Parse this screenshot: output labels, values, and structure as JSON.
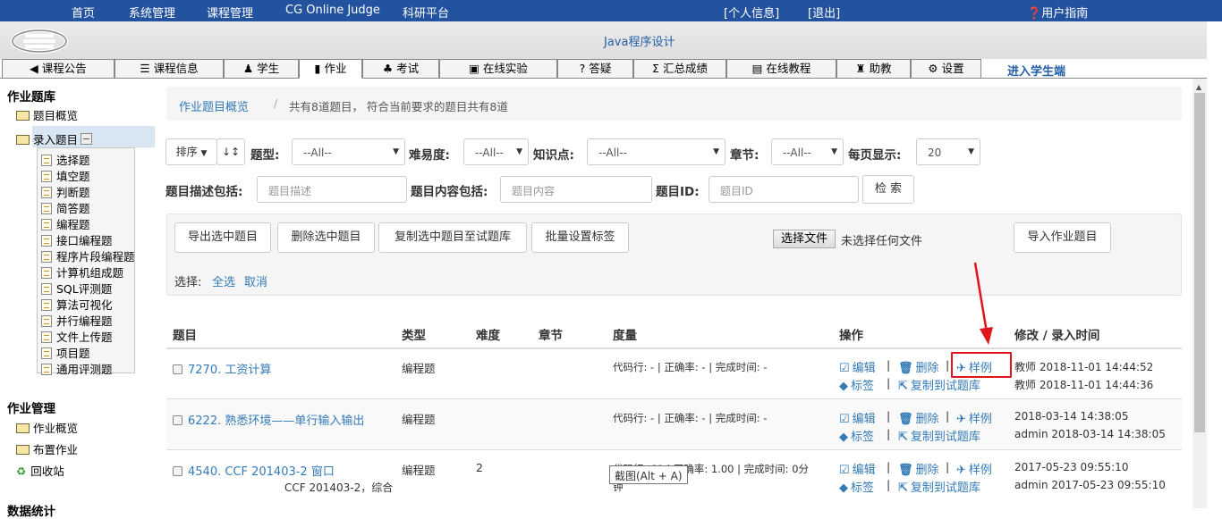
{
  "topbar": {
    "home": "首页",
    "system": "系统管理",
    "course_manage": "课程管理",
    "judge": "CG Online Judge",
    "research": "科研平台",
    "profile": "[个人信息]",
    "logout": "[退出]",
    "guide": "用户指南"
  },
  "course_title": "Java程序设计",
  "tabs": [
    {
      "label": "课程公告",
      "icon": "bullhorn-icon",
      "glyph": "📢"
    },
    {
      "label": "课程信息",
      "icon": "list-icon",
      "glyph": "☰"
    },
    {
      "label": "学生",
      "icon": "users-icon",
      "glyph": "👥"
    },
    {
      "label": "作业",
      "icon": "book-icon",
      "glyph": "▮"
    },
    {
      "label": "考试",
      "icon": "sitemap-icon",
      "glyph": "♟"
    },
    {
      "label": "在线实验",
      "icon": "monitor-icon",
      "glyph": "▣"
    },
    {
      "label": "答疑",
      "icon": "question-icon",
      "glyph": "?"
    },
    {
      "label": "汇总成绩",
      "icon": "sum-icon",
      "glyph": "Σ"
    },
    {
      "label": "在线教程",
      "icon": "book-open-icon",
      "glyph": "▤"
    },
    {
      "label": "助教",
      "icon": "assistant-icon",
      "glyph": "♜"
    },
    {
      "label": "设置",
      "icon": "gear-icon",
      "glyph": "⚙"
    }
  ],
  "student_link": "进入学生端",
  "sidebar": {
    "bank_title": "作业题库",
    "overview": "题目概览",
    "enter": "录入题目",
    "types": [
      "选择题",
      "填空题",
      "判断题",
      "简答题",
      "编程题",
      "接口编程题",
      "程序片段编程题",
      "计算机组成题",
      "SQL评测题",
      "算法可视化",
      "并行编程题",
      "文件上传题",
      "项目题",
      "通用评测题"
    ],
    "hw_title": "作业管理",
    "hw_overview": "作业概览",
    "assign": "布置作业",
    "recycle": "回收站",
    "stats_title": "数据统计"
  },
  "breadcrumb": {
    "link": "作业题目概览",
    "sep": "/",
    "summary": "共有8道题目， 符合当前要求的题目共有8道"
  },
  "filters": {
    "sort": "排序",
    "sort_icon": "↓↕",
    "type_label": "题型:",
    "type_value": "--All--",
    "difficulty_label": "难易度:",
    "difficulty_value": "--All--",
    "knowledge_label": "知识点:",
    "knowledge_value": "--All--",
    "chapter_label": "章节:",
    "chapter_value": "--All--",
    "per_page_label": "每页显示:",
    "per_page_value": "20",
    "desc_label": "题目描述包括:",
    "desc_placeholder": "题目描述",
    "content_label": "题目内容包括:",
    "content_placeholder": "题目内容",
    "id_label": "题目ID:",
    "id_placeholder": "题目ID",
    "search": "检 索"
  },
  "actions": {
    "export": "导出选中题目",
    "delete": "删除选中题目",
    "copy": "复制选中题目至试题库",
    "tags": "批量设置标签",
    "choose_file": "选择文件",
    "no_file": "未选择任何文件",
    "import": "导入作业题目",
    "select_label": "选择:",
    "select_all": "全选",
    "cancel": "取消"
  },
  "table": {
    "headers": {
      "title": "题目",
      "type": "类型",
      "difficulty": "难度",
      "chapter": "章节",
      "metrics": "度量",
      "ops": "操作",
      "time": "修改 / 录入时间"
    },
    "op_labels": {
      "edit": "编辑",
      "delete": "删除",
      "example": "样例",
      "tag": "标签",
      "copy": "复制到试题库"
    },
    "rows": [
      {
        "title": "7270. 工资计算",
        "type": "编程题",
        "difficulty": "",
        "chapter": "",
        "metrics": "代码行: - | 正确率: - | 完成时间: -",
        "modified": "教师 2018-11-01 14:44:52",
        "created": "教师 2018-11-01 14:44:36"
      },
      {
        "title": "6222. 熟悉环境——单行输入输出",
        "type": "编程题",
        "difficulty": "",
        "chapter": "",
        "metrics": "代码行: - | 正确率: - | 完成时间: -",
        "modified": "2018-03-14 14:38:05",
        "created": "admin 2018-03-14 14:38:05"
      },
      {
        "title": "4540. CCF 201403-2 窗口",
        "subtitle": "CCF 201403-2，综合",
        "type": "编程题",
        "difficulty": "2",
        "chapter": "",
        "metrics": "代码行: 60 | 正确率: 1.00 | 完成时间: 0分",
        "metrics2": "钟",
        "modified": "2017-05-23 09:55:10",
        "created": "admin 2017-05-23 09:55:10"
      }
    ]
  },
  "tooltip": "截图(Alt + A)",
  "colors": {
    "topbar": "#23539e",
    "link": "#337ab7",
    "highlight": "#e0161b",
    "arrow": "#e0161b"
  }
}
